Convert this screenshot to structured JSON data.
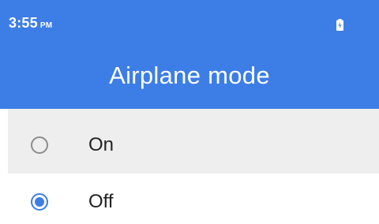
{
  "status_bar": {
    "time": "3:55",
    "ampm": "PM",
    "battery_icon": "battery-icon"
  },
  "header": {
    "title": "Airplane mode"
  },
  "options": [
    {
      "label": "On",
      "selected": false
    },
    {
      "label": "Off",
      "selected": true
    }
  ],
  "colors": {
    "accent": "#3d7ee6",
    "highlight_row": "#eeeeee"
  }
}
